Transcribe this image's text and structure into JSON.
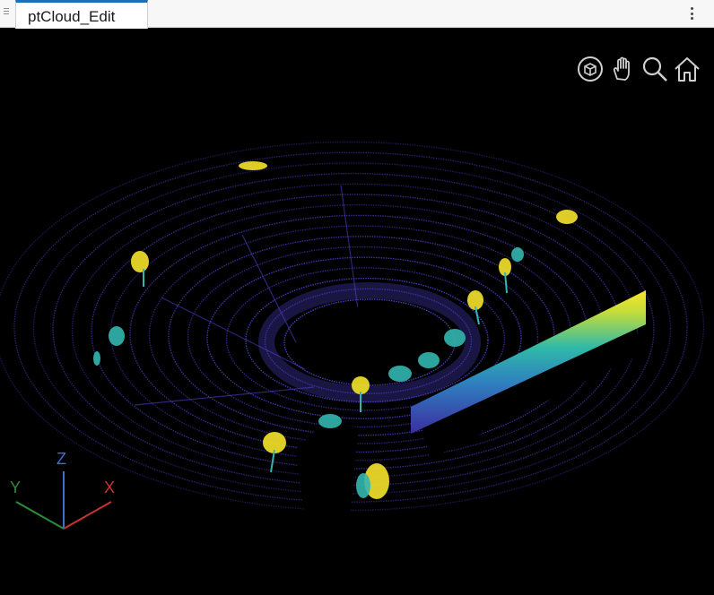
{
  "tab": {
    "title": "ptCloud_Edit"
  },
  "toolbar": {
    "icons": [
      "rotate-3d-icon",
      "pan-hand-icon",
      "zoom-icon",
      "home-icon"
    ]
  },
  "axes": {
    "x_label": "X",
    "y_label": "Y",
    "z_label": "Z"
  },
  "colors": {
    "ground": "#3a2c9a",
    "ground_light": "#4b3fc4",
    "teal": "#33b6b0",
    "yellow": "#f5e32a",
    "x_axis": "#c83232",
    "y_axis": "#2e8b3c",
    "z_axis": "#3a6fd1"
  }
}
